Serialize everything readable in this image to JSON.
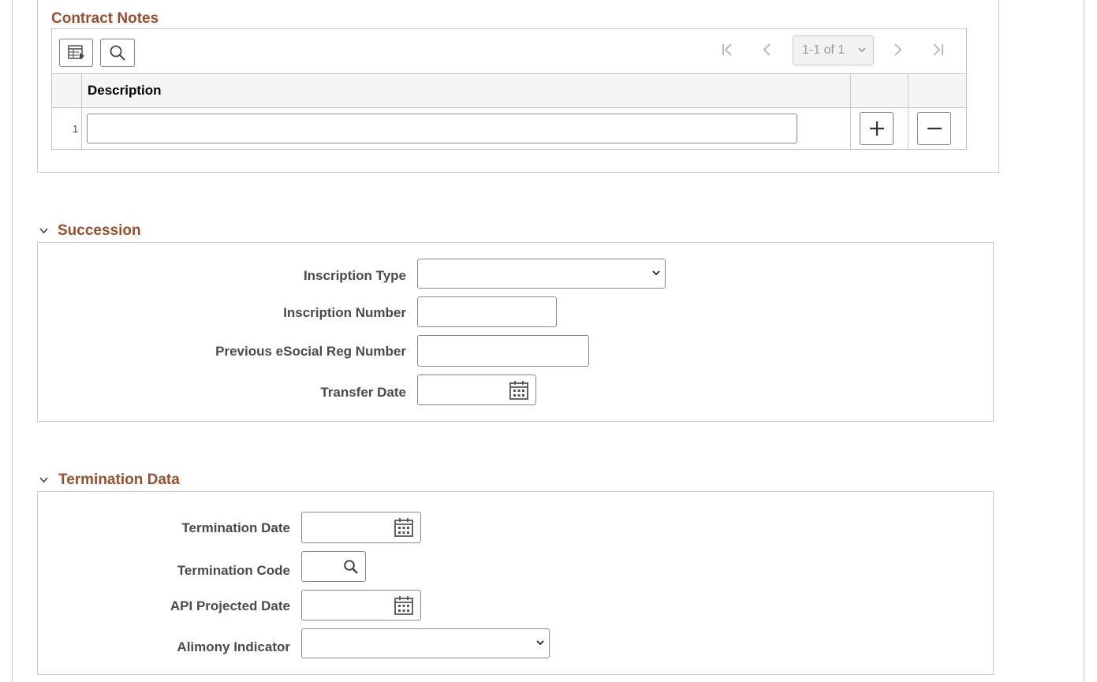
{
  "contract_notes": {
    "title": "Contract Notes",
    "pager_text": "1-1 of 1",
    "column_description": "Description",
    "rows": [
      {
        "num": "1",
        "description": ""
      }
    ]
  },
  "succession": {
    "title": "Succession",
    "inscription_type_label": "Inscription Type",
    "inscription_type_value": "",
    "inscription_number_label": "Inscription Number",
    "inscription_number_value": "",
    "previous_reg_label": "Previous eSocial Reg Number",
    "previous_reg_value": "",
    "transfer_date_label": "Transfer Date",
    "transfer_date_value": ""
  },
  "termination": {
    "title": "Termination Data",
    "termination_date_label": "Termination Date",
    "termination_date_value": "",
    "termination_code_label": "Termination Code",
    "termination_code_value": "",
    "api_projected_date_label": "API Projected Date",
    "api_projected_date_value": "",
    "alimony_indicator_label": "Alimony Indicator",
    "alimony_indicator_value": ""
  },
  "colors": {
    "accent": "#9a4f2c",
    "border": "#c8c8c8"
  }
}
